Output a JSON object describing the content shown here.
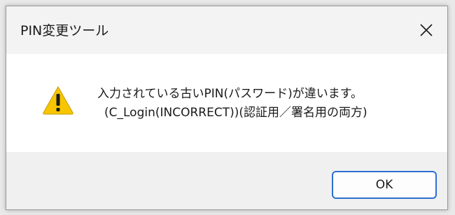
{
  "window": {
    "title": "PIN変更ツール",
    "close_icon": "close-icon"
  },
  "message": {
    "icon": "warning-icon",
    "line1": "入力されている古いPIN(パスワード)が違います。",
    "line2": "(C_Login(INCORRECT))(認証用／署名用の両方)"
  },
  "buttons": {
    "ok_label": "OK"
  },
  "colors": {
    "warning_fill": "#f7c600",
    "focus_border": "#2e6fd1"
  }
}
